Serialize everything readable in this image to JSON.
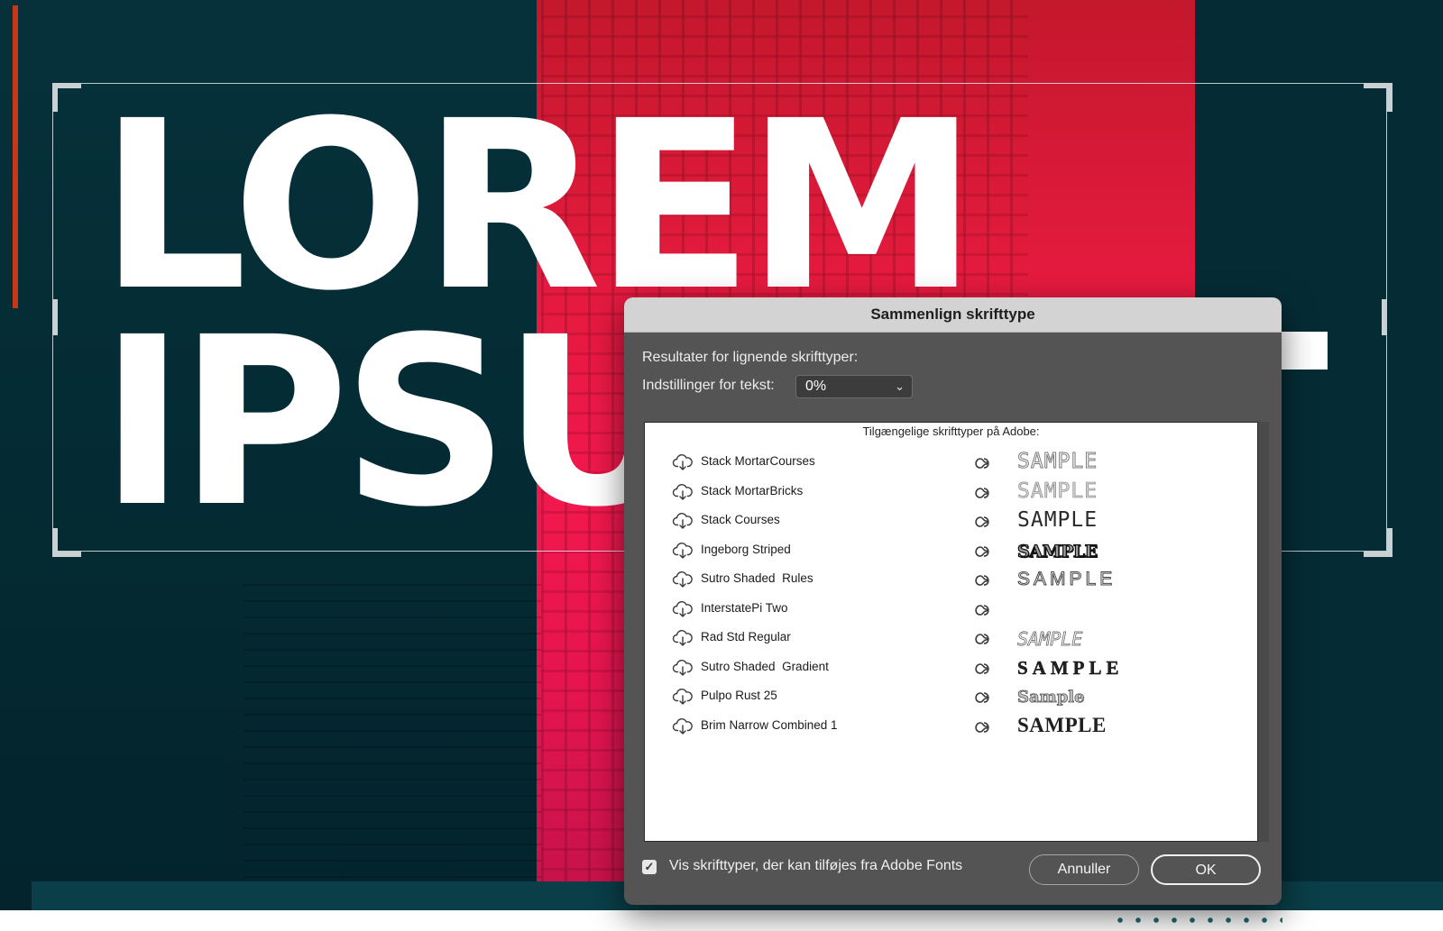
{
  "artwork": {
    "headline_line1": "LOREM",
    "headline_line2": "IPSU"
  },
  "dialog": {
    "title": "Sammenlign skrifttype",
    "results_label": "Resultater for lignende skrifttyper:",
    "text_settings_label": "Indstillinger for tekst:",
    "text_settings_value": "0%",
    "list_header": "Tilgængelige skrifttyper på Adobe:",
    "fonts": [
      {
        "name": "Stack MortarCourses",
        "sample": "SAMPLE",
        "download_icon": "cloud-download-icon",
        "cc_icon": "creative-cloud-icon"
      },
      {
        "name": "Stack MortarBricks",
        "sample": "SAMPLE",
        "download_icon": "cloud-download-icon",
        "cc_icon": "creative-cloud-icon"
      },
      {
        "name": "Stack Courses",
        "sample": "SAMPLE",
        "download_icon": "cloud-download-icon",
        "cc_icon": "creative-cloud-icon"
      },
      {
        "name": "Ingeborg Striped",
        "sample": "SAMPLE",
        "download_icon": "cloud-download-icon",
        "cc_icon": "creative-cloud-icon"
      },
      {
        "name": "Sutro Shaded  Rules",
        "sample": "SAMPLE",
        "download_icon": "cloud-download-icon",
        "cc_icon": "creative-cloud-icon"
      },
      {
        "name": "InterstatePi Two",
        "sample": "",
        "download_icon": "cloud-download-icon",
        "cc_icon": "creative-cloud-icon"
      },
      {
        "name": "Rad Std Regular",
        "sample": "SAMPLE",
        "download_icon": "cloud-download-icon",
        "cc_icon": "creative-cloud-icon"
      },
      {
        "name": "Sutro Shaded  Gradient",
        "sample": "SAMPLE",
        "download_icon": "cloud-download-icon",
        "cc_icon": "creative-cloud-icon"
      },
      {
        "name": "Pulpo Rust 25",
        "sample": "Sample",
        "download_icon": "cloud-download-icon",
        "cc_icon": "creative-cloud-icon"
      },
      {
        "name": "Brim Narrow Combined 1",
        "sample": "SAMPLE",
        "download_icon": "cloud-download-icon",
        "cc_icon": "creative-cloud-icon"
      }
    ],
    "show_adobe_fonts_checked": true,
    "show_adobe_fonts_label": "Vis skrifttyper, der kan tilføjes fra Adobe Fonts",
    "cancel_label": "Annuller",
    "ok_label": "OK"
  },
  "colors": {
    "art_dark": "#052c35",
    "art_red": "#e41a3e",
    "dialog_bg": "#545454",
    "titlebar_bg": "#d3d3d3"
  }
}
